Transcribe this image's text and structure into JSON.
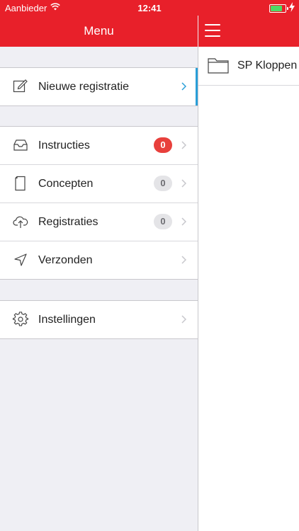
{
  "status_bar": {
    "carrier": "Aanbieder",
    "time": "12:41",
    "battery_level": 0.9
  },
  "menu": {
    "title": "Menu",
    "group1": [
      {
        "label": "Nieuwe registratie",
        "icon": "compose-icon"
      }
    ],
    "group2": [
      {
        "label": "Instructies",
        "icon": "inbox-icon",
        "badge": "0",
        "badge_style": "red"
      },
      {
        "label": "Concepten",
        "icon": "document-icon",
        "badge": "0",
        "badge_style": "grey"
      },
      {
        "label": "Registraties",
        "icon": "cloud-upload-icon",
        "badge": "0",
        "badge_style": "grey"
      },
      {
        "label": "Verzonden",
        "icon": "send-icon"
      }
    ],
    "group3": [
      {
        "label": "Instellingen",
        "icon": "gear-icon"
      }
    ]
  },
  "detail": {
    "folder_label": "SP Kloppen"
  },
  "colors": {
    "brand": "#e8202a",
    "accent": "#2a9fd8",
    "badge_red": "#e8403c"
  }
}
